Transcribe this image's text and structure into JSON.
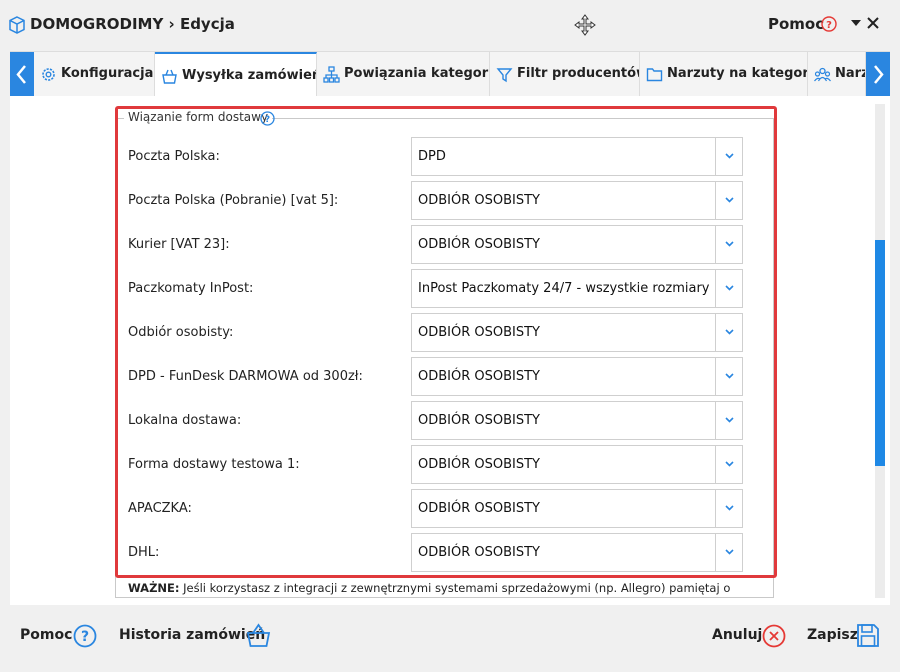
{
  "window": {
    "title": "DOMOGRODIMY › Edycja",
    "help_label": "Pomoc",
    "icons": [
      "box-icon",
      "move-icon",
      "help-icon",
      "dropdown-icon",
      "close-icon"
    ]
  },
  "tabs": [
    {
      "label": "Konfiguracja",
      "icon": "gear-icon",
      "active": false
    },
    {
      "label": "Wysyłka zamówień",
      "icon": "shipping-icon",
      "active": true
    },
    {
      "label": "Powiązania kategorii",
      "icon": "tree-icon",
      "active": false
    },
    {
      "label": "Filtr producentów",
      "icon": "filter-icon",
      "active": false
    },
    {
      "label": "Narzuty na kategorie",
      "icon": "folder-icon",
      "active": false
    },
    {
      "label": "Narzu",
      "icon": "users-icon",
      "active": false
    }
  ],
  "section": {
    "legend": "Wiązanie form dostawy",
    "rows": [
      {
        "label": "Poczta Polska:",
        "value": "DPD"
      },
      {
        "label": "Poczta Polska (Pobranie) [vat 5]:",
        "value": "ODBIÓR OSOBISTY"
      },
      {
        "label": "Kurier [VAT 23]:",
        "value": "ODBIÓR OSOBISTY"
      },
      {
        "label": "Paczkomaty InPost:",
        "value": "InPost Paczkomaty 24/7 - wszystkie rozmiary"
      },
      {
        "label": "Odbiór osobisty:",
        "value": "ODBIÓR OSOBISTY"
      },
      {
        "label": "DPD - FunDesk DARMOWA od 300zł:",
        "value": "ODBIÓR OSOBISTY"
      },
      {
        "label": "Lokalna dostawa:",
        "value": "ODBIÓR OSOBISTY"
      },
      {
        "label": "Forma dostawy testowa 1:",
        "value": "ODBIÓR OSOBISTY"
      },
      {
        "label": "APACZKA:",
        "value": "ODBIÓR OSOBISTY"
      },
      {
        "label": "DHL:",
        "value": "ODBIÓR OSOBISTY"
      }
    ],
    "note_bold": "WAŻNE:",
    "note_text": " Jeśli korzystasz z integracji z zewnętrznymi systemami sprzedażowymi (np. Allegro) pamiętaj o"
  },
  "footer": {
    "help_label": "Pomoc",
    "history_label": "Historia zamówień",
    "cancel_label": "Anuluj",
    "save_label": "Zapisz"
  },
  "colors": {
    "accent": "#2a86e0",
    "highlight": "#e0393c",
    "danger": "#e53935"
  }
}
